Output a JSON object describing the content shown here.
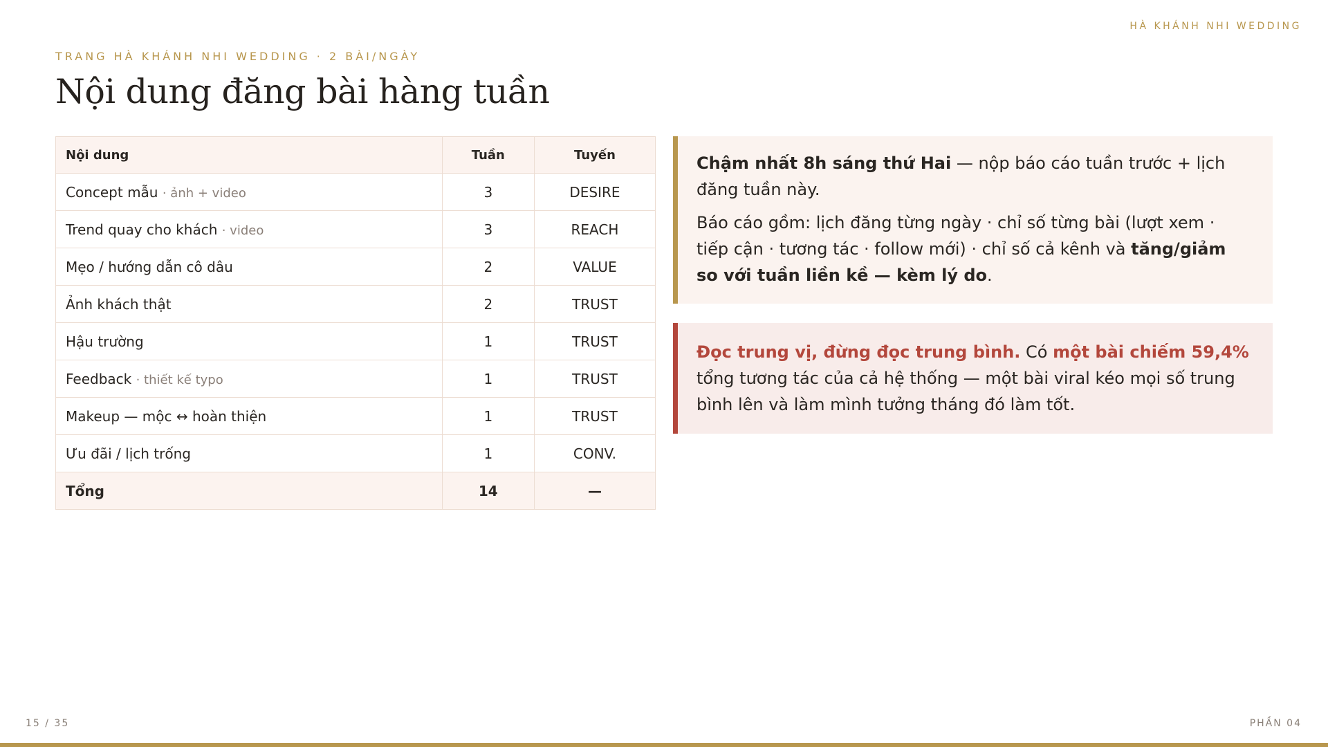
{
  "header": {
    "brand": "HÀ KHÁNH NHI WEDDING",
    "eyebrow": "TRANG HÀ KHÁNH NHI WEDDING · 2 BÀI/NGÀY",
    "title": "Nội dung đăng bài hàng tuần"
  },
  "table": {
    "columns": [
      "Nội dung",
      "Tuần",
      "Tuyến"
    ],
    "rows": [
      {
        "content": "Concept mẫu",
        "note": "· ảnh + video",
        "week": "3",
        "track": "DESIRE"
      },
      {
        "content": "Trend quay cho khách",
        "note": "· video",
        "week": "3",
        "track": "REACH"
      },
      {
        "content": "Mẹo / hướng dẫn cô dâu",
        "note": "",
        "week": "2",
        "track": "VALUE"
      },
      {
        "content": "Ảnh khách thật",
        "note": "",
        "week": "2",
        "track": "TRUST"
      },
      {
        "content": "Hậu trường",
        "note": "",
        "week": "1",
        "track": "TRUST"
      },
      {
        "content": "Feedback",
        "note": "· thiết kế typo",
        "week": "1",
        "track": "TRUST"
      },
      {
        "content": "Makeup — mộc ↔ hoàn thiện",
        "note": "",
        "week": "1",
        "track": "TRUST"
      },
      {
        "content": "Ưu đãi / lịch trống",
        "note": "",
        "week": "1",
        "track": "CONV."
      }
    ],
    "total": {
      "label": "Tổng",
      "week": "14",
      "track": "—"
    }
  },
  "callout_deadline": {
    "lead_bold": "Chậm nhất 8h sáng thứ Hai",
    "lead_rest": " — nộp báo cáo tuần trước + lịch đăng tuần này.",
    "body": "Báo cáo gồm: lịch đăng từng ngày · chỉ số từng bài (lượt xem · tiếp cận · tương tác · follow mới) · chỉ số cả kênh và ",
    "body_bold": "tăng/giảm so với tuần liền kề — kèm lý do",
    "body_end": "."
  },
  "callout_median": {
    "lead_bold": "Đọc trung vị, đừng đọc trung bình.",
    "mid": " Có ",
    "highlight": "một bài chiếm 59,4%",
    "rest": " tổng tương tác của cả hệ thống — một bài viral kéo mọi số trung bình lên và làm mình tưởng tháng đó làm tốt."
  },
  "footer": {
    "page": "15 / 35",
    "section": "PHẦN 04"
  },
  "colors": {
    "accent_gold": "#b8974e",
    "accent_red": "#b3473c",
    "table_header_bg": "#fcf3ef",
    "callout_gold_bg": "#fbf3ef",
    "callout_red_bg": "#f8ecea"
  }
}
